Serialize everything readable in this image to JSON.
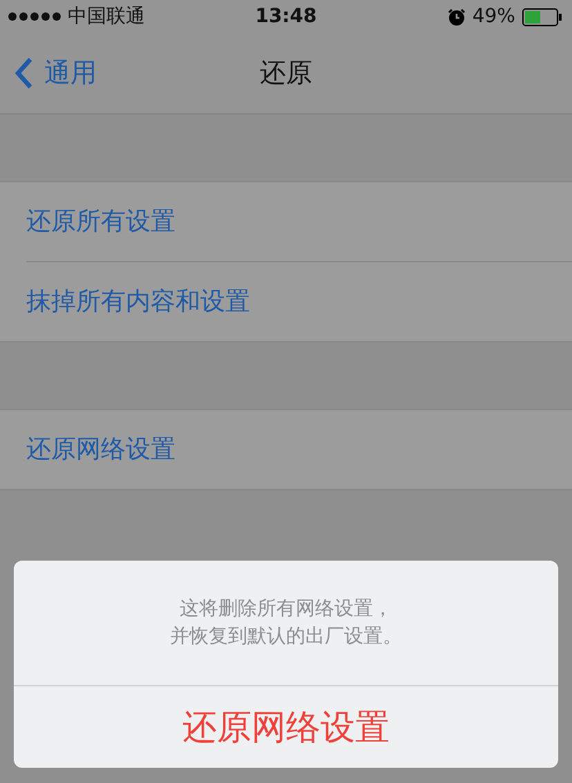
{
  "status_bar": {
    "carrier": "中国联通",
    "time": "13:48",
    "battery": "49%"
  },
  "nav": {
    "back": "通用",
    "title": "还原"
  },
  "groups": [
    {
      "items": [
        {
          "label": "还原所有设置"
        },
        {
          "label": "抹掉所有内容和设置"
        }
      ]
    },
    {
      "items": [
        {
          "label": "还原网络设置"
        }
      ]
    }
  ],
  "action_sheet": {
    "message_lines": [
      "这将删除所有网络设置，",
      "并恢复到默认的出厂设置。"
    ],
    "action": "还原网络设置"
  }
}
